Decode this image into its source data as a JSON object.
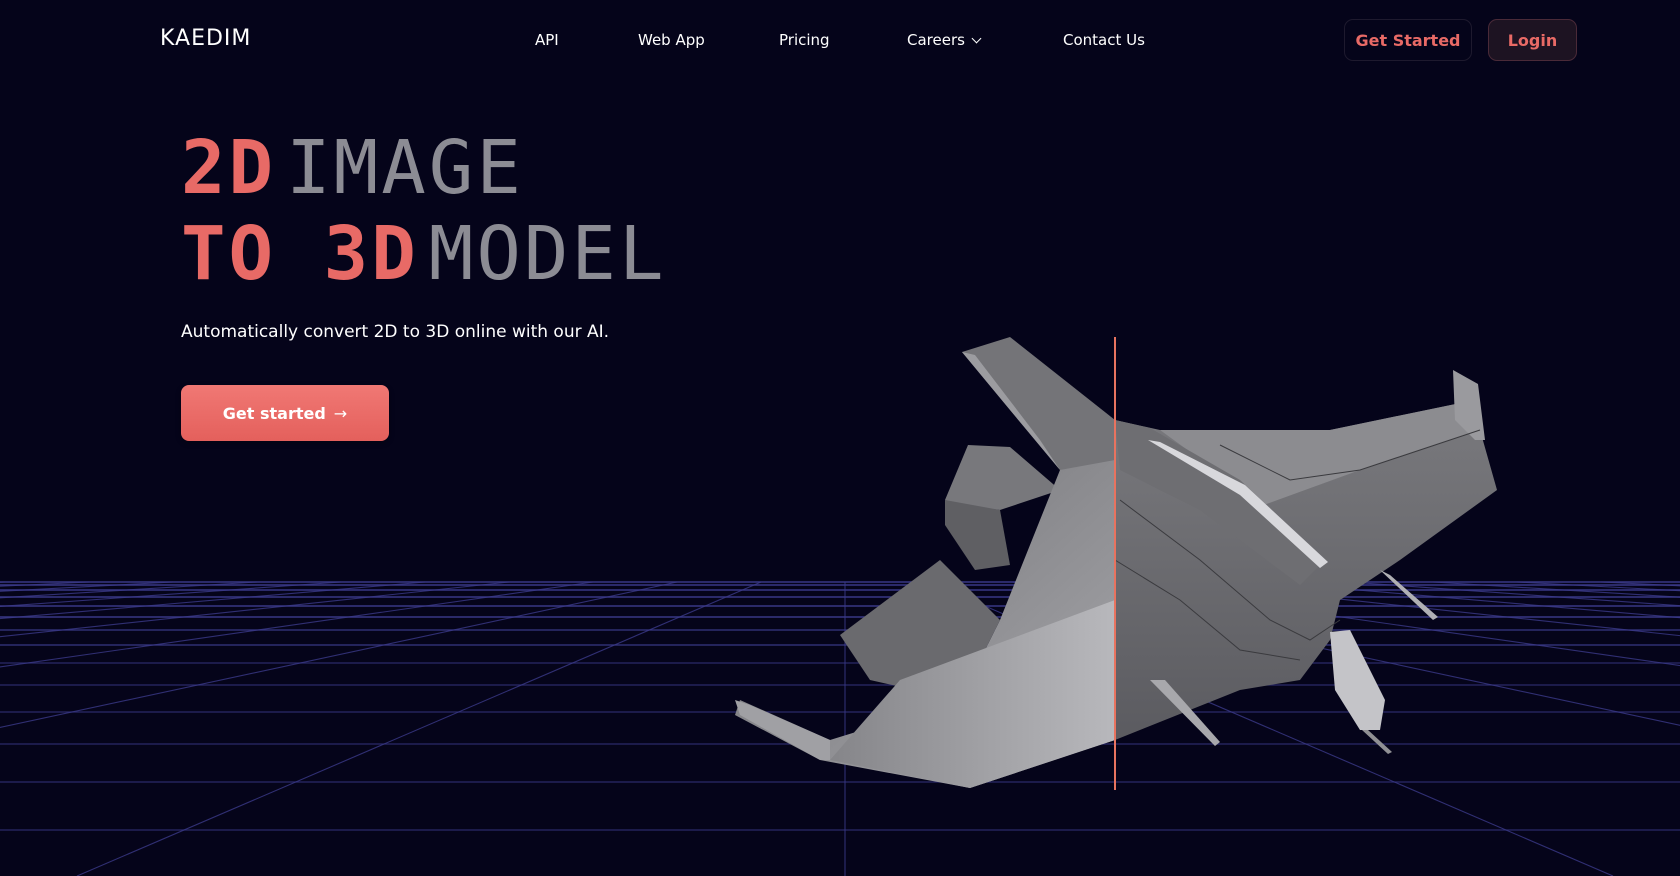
{
  "brand": {
    "logo": "KAEDIM"
  },
  "nav": {
    "links": [
      {
        "label": "API"
      },
      {
        "label": "Web App"
      },
      {
        "label": "Pricing"
      },
      {
        "label": "Careers",
        "has_dropdown": true
      },
      {
        "label": "Contact Us"
      }
    ],
    "get_started_label": "Get Started",
    "login_label": "Login"
  },
  "hero": {
    "line1_accent": "2D",
    "line1_muted": "IMAGE",
    "line2_accent": "TO 3D",
    "line2_muted": "MODEL",
    "subtitle": "Automatically convert 2D to 3D online with our AI.",
    "cta_label": "Get started",
    "cta_icon": "arrow-right-icon"
  },
  "visual": {
    "subject": "3D spaceship model with before/after split comparison",
    "split_divider_color": "#e8735f"
  },
  "colors": {
    "background": "#05041a",
    "accent": "#e86a66",
    "muted_heading": "#8c8c94",
    "grid_line": "#3b3a8a"
  }
}
